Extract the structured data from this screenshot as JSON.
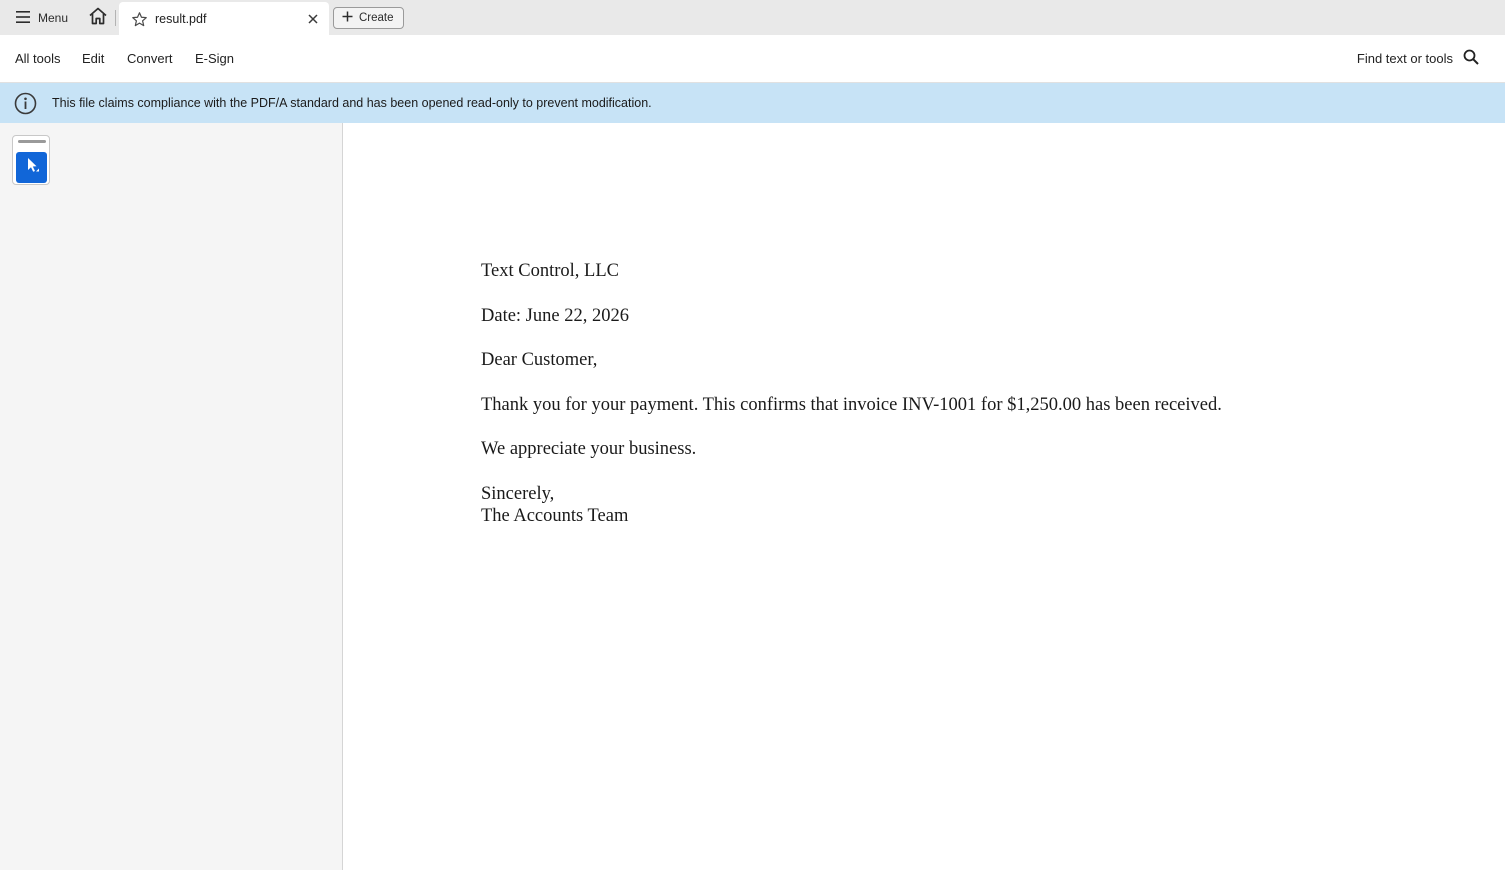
{
  "tabbar": {
    "menu_label": "Menu",
    "tab_title": "result.pdf",
    "create_label": "Create"
  },
  "toolbar": {
    "items": [
      "All tools",
      "Edit",
      "Convert",
      "E-Sign"
    ],
    "find_label": "Find text or tools"
  },
  "banner": {
    "message": "This file claims compliance with the PDF/A standard and has been opened read-only to prevent modification."
  },
  "document": {
    "company": "Text Control, LLC",
    "date_line": "Date: June 22, 2026",
    "salutation": "Dear Customer,",
    "body": "Thank you for your payment. This confirms that invoice INV-1001 for $1,250.00 has been received.",
    "appreciation": "We appreciate your business.",
    "closing": "Sincerely,",
    "signature": "The Accounts Team"
  },
  "colors": {
    "banner_bg": "#c7e3f6",
    "accent": "#1166d8",
    "tabbar_bg": "#e9e9e9",
    "panel_bg": "#f5f5f5"
  },
  "icons": [
    "hamburger-icon",
    "home-icon",
    "star-icon",
    "close-icon",
    "plus-icon",
    "search-icon",
    "info-icon",
    "cursor-icon"
  ]
}
